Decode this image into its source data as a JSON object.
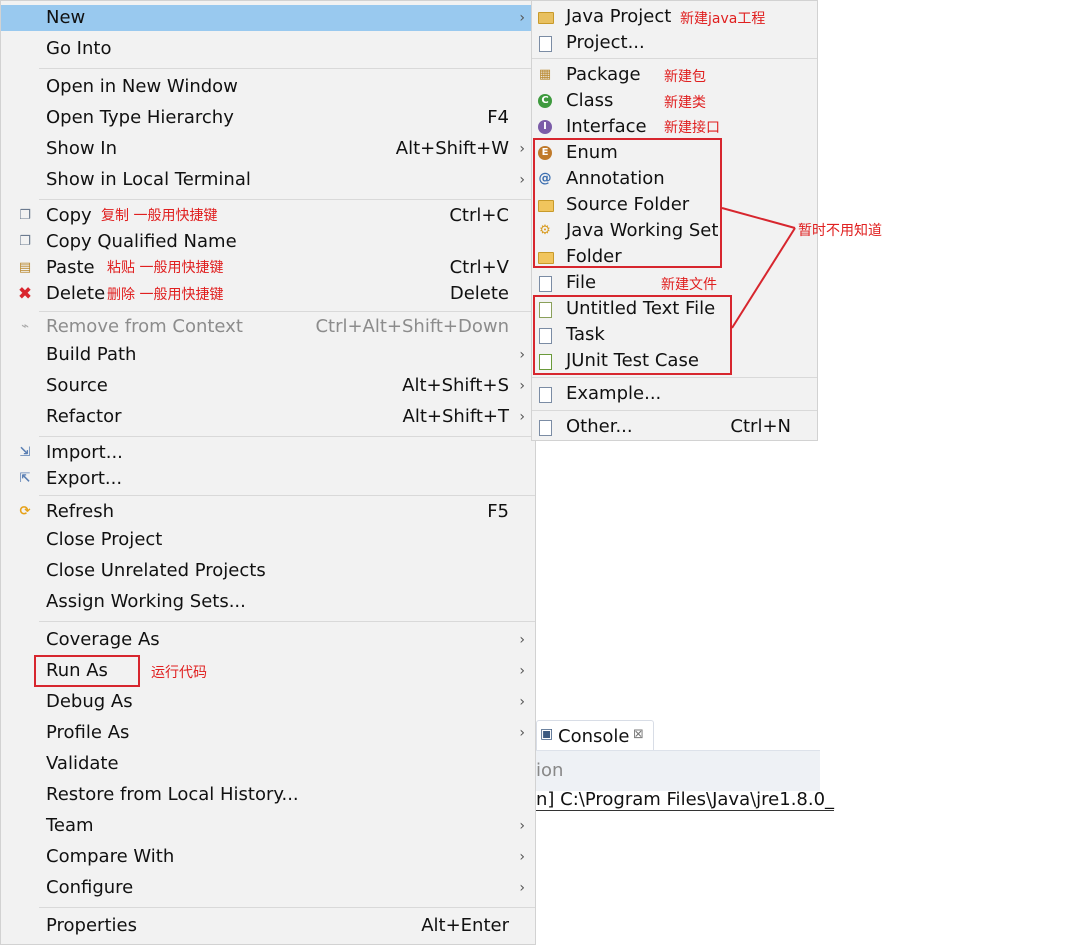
{
  "main_menu": {
    "new": {
      "label": "New"
    },
    "go_into": {
      "label": "Go Into"
    },
    "open_new_window": {
      "label": "Open in New Window"
    },
    "open_type_hierarchy": {
      "label": "Open Type Hierarchy",
      "accel": "F4"
    },
    "show_in": {
      "label": "Show In",
      "accel": "Alt+Shift+W"
    },
    "show_in_terminal": {
      "label": "Show in Local Terminal"
    },
    "copy": {
      "label": "Copy",
      "accel": "Ctrl+C"
    },
    "copy_qualified": {
      "label": "Copy Qualified Name"
    },
    "paste": {
      "label": "Paste",
      "accel": "Ctrl+V"
    },
    "delete": {
      "label": "Delete",
      "accel": "Delete"
    },
    "remove_context": {
      "label": "Remove from Context",
      "accel": "Ctrl+Alt+Shift+Down"
    },
    "build_path": {
      "label": "Build Path"
    },
    "source": {
      "label": "Source",
      "accel": "Alt+Shift+S"
    },
    "refactor": {
      "label": "Refactor",
      "accel": "Alt+Shift+T"
    },
    "import": {
      "label": "Import..."
    },
    "export": {
      "label": "Export..."
    },
    "refresh": {
      "label": "Refresh",
      "accel": "F5"
    },
    "close_project": {
      "label": "Close Project"
    },
    "close_unrelated": {
      "label": "Close Unrelated Projects"
    },
    "assign_working_sets": {
      "label": "Assign Working Sets..."
    },
    "coverage_as": {
      "label": "Coverage As"
    },
    "run_as": {
      "label": "Run As"
    },
    "debug_as": {
      "label": "Debug As"
    },
    "profile_as": {
      "label": "Profile As"
    },
    "validate": {
      "label": "Validate"
    },
    "restore_history": {
      "label": "Restore from Local History..."
    },
    "team": {
      "label": "Team"
    },
    "compare_with": {
      "label": "Compare With"
    },
    "configure": {
      "label": "Configure"
    },
    "properties": {
      "label": "Properties",
      "accel": "Alt+Enter"
    },
    "arrow": "›"
  },
  "new_submenu": {
    "java_project": "Java Project",
    "project": "Project...",
    "package": "Package",
    "class": "Class",
    "interface": "Interface",
    "enum": "Enum",
    "annotation": "Annotation",
    "source_folder": "Source Folder",
    "java_working_set": "Java Working Set",
    "folder": "Folder",
    "file": "File",
    "untitled_text_file": "Untitled Text File",
    "task": "Task",
    "junit_test_case": "JUnit Test Case",
    "example": "Example...",
    "other": "Other...",
    "other_accel": "Ctrl+N"
  },
  "annotations": {
    "copy_note": "复制 一般用快捷键",
    "paste_note": "粘贴 一般用快捷键",
    "delete_note": "删除 一般用快捷键",
    "run_as_note": "运行代码",
    "java_project_note": "新建java工程",
    "package_note": "新建包",
    "class_note": "新建类",
    "interface_note": "新建接口",
    "file_note": "新建文件",
    "unused_note": "暂时不用知道"
  },
  "console": {
    "prev_tab_fragment": "ion",
    "tab_label": "Console",
    "close_glyph": "⊠",
    "line": "n] C:\\Program Files\\Java\\jre1.8.0_"
  },
  "colors": {
    "highlight": "#99c9ef",
    "annotation_red": "#e02020",
    "menu_bg": "#f2f2f2"
  }
}
